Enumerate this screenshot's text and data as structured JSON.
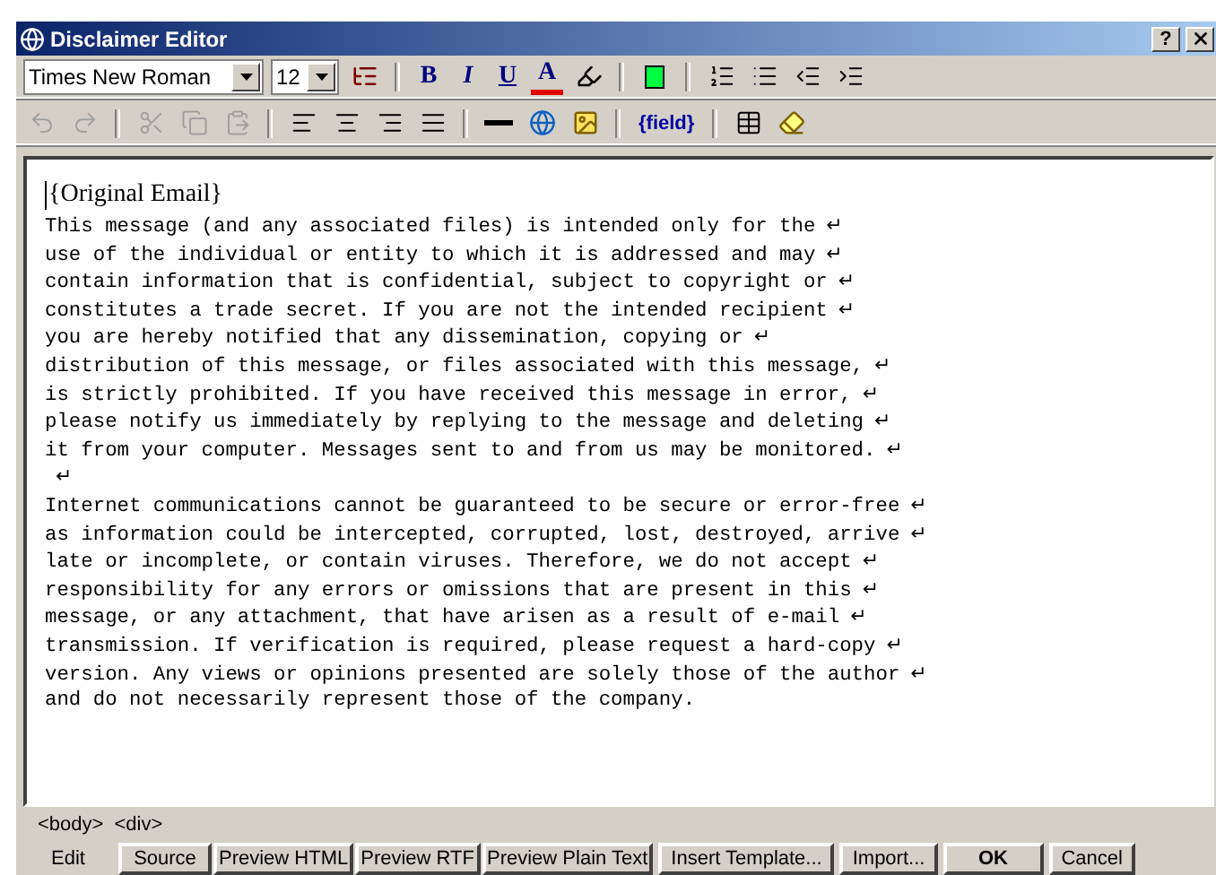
{
  "window": {
    "title": "Disclaimer Editor",
    "help": "?"
  },
  "format_toolbar": {
    "font": "Times New Roman",
    "size": "12",
    "style_buttons": [
      "B",
      "I",
      "U",
      "A"
    ]
  },
  "edit_toolbar": {
    "history_actions": [
      {
        "disabled": true
      },
      {
        "disabled": true
      }
    ],
    "clipboard_actions": [
      {
        "disabled": true
      },
      {
        "disabled": true
      },
      {
        "disabled": true
      }
    ],
    "field_button": "{field}"
  },
  "editor": {
    "heading": "{Original Email}",
    "lines": [
      {
        "text": "This message (and any associated files) is intended only for the",
        "end": "↵"
      },
      {
        "text": "use of the individual or entity to which it is addressed and may",
        "end": "↵"
      },
      {
        "text": "contain information that is confidential, subject to copyright or",
        "end": "↵"
      },
      {
        "text": "constitutes a trade secret. If you are not the intended recipient",
        "end": "↵"
      },
      {
        "text": "you are hereby notified that any dissemination, copying or",
        "end": "↵"
      },
      {
        "text": "distribution of this message, or files associated with this message,",
        "end": "↵"
      },
      {
        "text": "is strictly prohibited. If you have received this message in error,",
        "end": "↵"
      },
      {
        "text": "please notify us immediately by replying to the message and deleting",
        "end": "↵"
      },
      {
        "text": "it from your computer. Messages sent to and from us may be monitored.",
        "end": "↵"
      },
      {
        "end": "↵"
      },
      {
        "text": "Internet communications cannot be guaranteed to be secure or error-free",
        "end": "↵"
      },
      {
        "text": "as information could be intercepted, corrupted, lost, destroyed, arrive",
        "end": "↵"
      },
      {
        "text": "late or incomplete, or contain viruses. Therefore, we do not accept",
        "end": "↵"
      },
      {
        "text": "responsibility for any errors or omissions that are present in this",
        "end": "↵"
      },
      {
        "text": "message, or any attachment, that have arisen as a result of e-mail",
        "end": "↵"
      },
      {
        "text": "transmission. If verification is required, please request a hard-copy",
        "end": "↵"
      },
      {
        "text": "version. Any views or opinions presented are solely those of the author",
        "end": "↵"
      },
      {
        "text": "and do not necessarily represent those of the company."
      }
    ]
  },
  "tag_path": [
    "<body>",
    "<div>"
  ],
  "tabs": [
    {
      "label": "Edit",
      "selected": true
    },
    {
      "label": "Source",
      "selected": false
    },
    {
      "label": "Preview HTML",
      "selected": false
    },
    {
      "label": "Preview RTF",
      "selected": false
    },
    {
      "label": "Preview Plain Text",
      "selected": false
    }
  ],
  "buttons": [
    {
      "label": "Insert Template..."
    },
    {
      "label": "Import..."
    },
    {
      "label": "OK",
      "kind": "default"
    },
    {
      "label": "Cancel"
    }
  ]
}
